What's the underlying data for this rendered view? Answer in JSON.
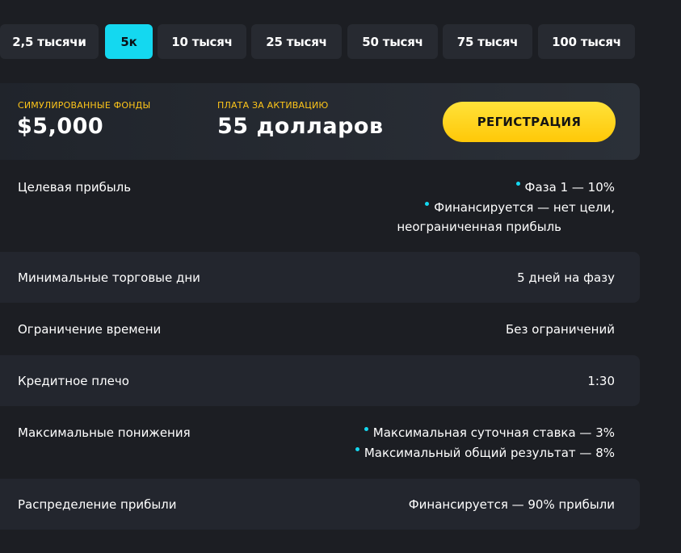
{
  "tabs": [
    {
      "label": "2,5 тысячи",
      "active": false
    },
    {
      "label": "5к",
      "active": true
    },
    {
      "label": "10 тысяч",
      "active": false
    },
    {
      "label": "25 тысяч",
      "active": false
    },
    {
      "label": "50 тысяч",
      "active": false
    },
    {
      "label": "75 тысяч",
      "active": false
    },
    {
      "label": "100 тысяч",
      "active": false
    }
  ],
  "header": {
    "funds_label": "СИМУЛИРОВАННЫЕ ФОНДЫ",
    "funds_value": "$5,000",
    "fee_label": "ПЛАТА ЗА АКТИВАЦИЮ",
    "fee_value": "55 долларов",
    "register_label": "РЕГИСТРАЦИЯ"
  },
  "rows": {
    "target": {
      "label": "Целевая прибыль",
      "bullet1": "Фаза 1 — 10%",
      "bullet2": "Финансируется — нет цели,",
      "bullet2_cont": "неограниченная прибыль"
    },
    "min_days": {
      "label": "Минимальные торговые дни",
      "value": "5 дней на фазу"
    },
    "time_limit": {
      "label": "Ограничение времени",
      "value": "Без ограничений"
    },
    "leverage": {
      "label": "Кредитное плечо",
      "value": "1:30"
    },
    "drawdown": {
      "label": "Максимальные понижения",
      "bullet1": "Максимальная суточная ставка — 3%",
      "bullet2": "Максимальный общий результат — 8%"
    },
    "profit_split": {
      "label": "Распределение прибыли",
      "value": "Финансируется — 90% прибыли"
    }
  },
  "colors": {
    "background": "#1c1e23",
    "accent_cyan": "#14d8f0",
    "accent_yellow": "#ffc619",
    "button_yellow": "#ffd31c"
  }
}
